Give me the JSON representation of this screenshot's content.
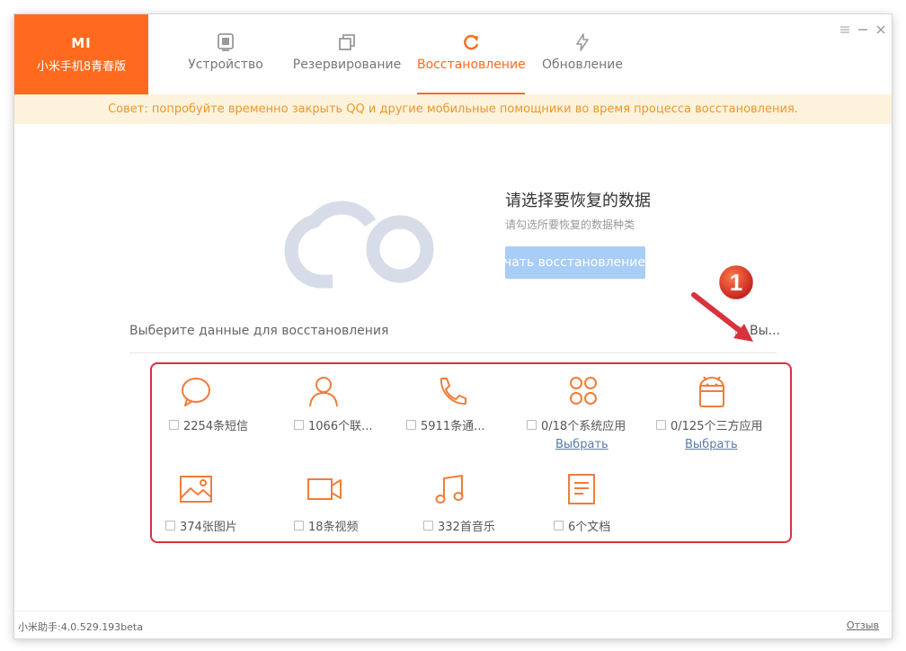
{
  "brand": {
    "logo": "MI",
    "device": "小米手机8青春版",
    "color": "#ff6a1f"
  },
  "tabs": [
    {
      "label": "Устройство",
      "icon": "device-icon",
      "active": false
    },
    {
      "label": "Резервирование",
      "icon": "backup-icon",
      "active": false
    },
    {
      "label": "Восстановление",
      "icon": "restore-icon",
      "active": true
    },
    {
      "label": "Обновление",
      "icon": "update-icon",
      "active": false
    }
  ],
  "window_controls": [
    "menu-icon",
    "minimize-icon",
    "close-icon"
  ],
  "tip": "Совет: попробуйте временно закрыть QQ и другие мобильные помощники во время процесса восстановления.",
  "hero": {
    "title": "请选择要恢复的数据",
    "subtitle": "请勾选所要恢复的数据种类",
    "start_button": "Начать восстановление"
  },
  "selection": {
    "label": "Выберите данные для восстановления",
    "select_all": "Вы..."
  },
  "categories": [
    {
      "icon": "message-icon",
      "label": "2254条短信"
    },
    {
      "icon": "contacts-icon",
      "label": "1066个联..."
    },
    {
      "icon": "phone-icon",
      "label": "5911条通..."
    },
    {
      "icon": "system-apps-icon",
      "label": "0/18个系统应用",
      "link": "Выбрать"
    },
    {
      "icon": "android-icon",
      "label": "0/125个三方应用",
      "link": "Выбрать"
    },
    {
      "icon": "image-icon",
      "label": "374张图片"
    },
    {
      "icon": "video-icon",
      "label": "18条视频"
    },
    {
      "icon": "music-icon",
      "label": "332首音乐"
    },
    {
      "icon": "document-icon",
      "label": "6个文档"
    }
  ],
  "annotation": {
    "number": "1"
  },
  "status": {
    "version": "小米助手:4.0.529.193beta",
    "feedback": "Отзыв"
  },
  "colors": {
    "accent": "#ff6a1f",
    "tip_bg": "#fdf3dc",
    "tip_text": "#f0962a",
    "button_disabled": "#a8cdf6",
    "highlight": "#d8323b"
  }
}
